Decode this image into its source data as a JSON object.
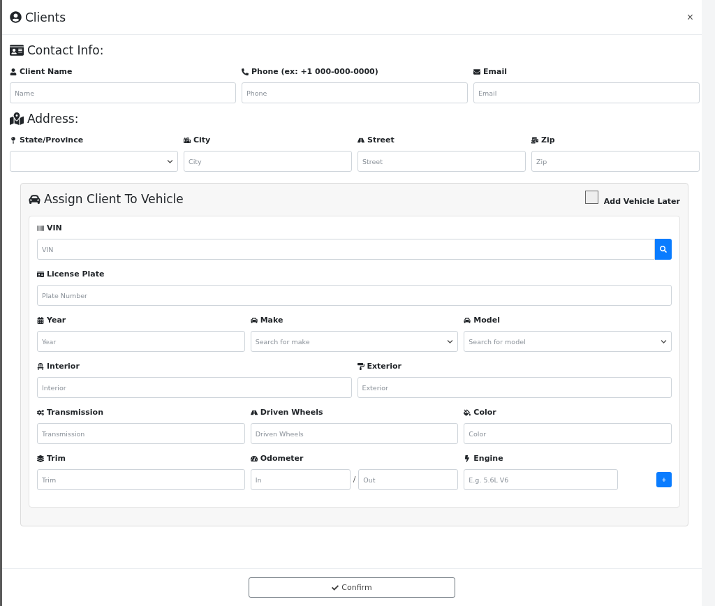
{
  "dialog": {
    "title": "Clients",
    "close": "×"
  },
  "contact": {
    "heading": "Contact Info:",
    "fields": [
      {
        "label": "Client Name",
        "kind": "text",
        "placeholder": "Name"
      },
      {
        "label": "Phone (ex: +1 000-000-0000)",
        "kind": "text",
        "placeholder": "Phone"
      },
      {
        "label": "Email",
        "kind": "text",
        "placeholder": "Email"
      }
    ]
  },
  "address": {
    "heading": "Address:",
    "fields": [
      {
        "label": "State/Province",
        "kind": "select"
      },
      {
        "label": "City",
        "kind": "text",
        "placeholder": "City"
      },
      {
        "label": "Street",
        "kind": "text",
        "placeholder": "Street"
      },
      {
        "label": "Zip",
        "kind": "text",
        "placeholder": "Zip"
      }
    ]
  },
  "vehicle": {
    "heading": "Assign Client To Vehicle",
    "add_later": {
      "label": "Add Vehicle Later",
      "checked": false
    },
    "rows": [
      [
        {
          "label": "VIN",
          "kind": "search",
          "placeholder": "VIN"
        }
      ],
      [
        {
          "label": "License Plate",
          "kind": "text",
          "placeholder": "Plate Number"
        }
      ],
      [
        {
          "label": "Year",
          "kind": "text",
          "placeholder": "Year"
        },
        {
          "label": "Make",
          "kind": "select",
          "placeholder": "Search for make"
        },
        {
          "label": "Model",
          "kind": "select",
          "placeholder": "Search for model"
        }
      ],
      [
        {
          "label": "Interior",
          "kind": "text",
          "placeholder": "Interior"
        },
        {
          "label": "Exterior",
          "kind": "text",
          "placeholder": "Exterior"
        }
      ],
      [
        {
          "label": "Transmission",
          "kind": "text",
          "placeholder": "Transmission"
        },
        {
          "label": "Driven Wheels",
          "kind": "text",
          "placeholder": "Driven Wheels"
        },
        {
          "label": "Color",
          "kind": "text",
          "placeholder": "Color"
        }
      ],
      [
        {
          "label": "Trim",
          "kind": "text",
          "placeholder": "Trim"
        },
        {
          "label": "Odometer",
          "kind": "range",
          "placeholders": [
            "In",
            "Out"
          ],
          "separator": "/"
        },
        {
          "label": "Engine",
          "kind": "add",
          "placeholder": "E.g. 5.6L V6",
          "button": "+"
        }
      ]
    ]
  },
  "footer": {
    "confirm": "Confirm"
  }
}
